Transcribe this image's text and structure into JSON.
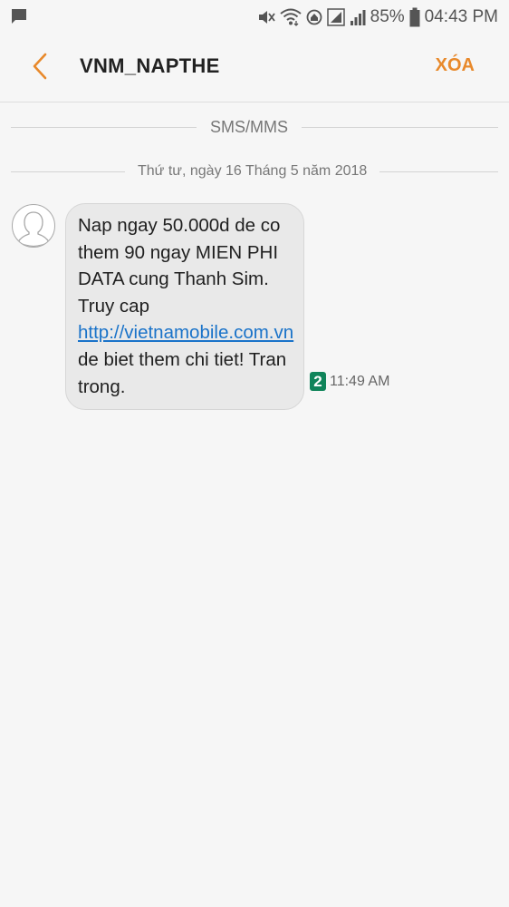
{
  "status_bar": {
    "battery": "85%",
    "time": "04:43 PM",
    "icons": [
      "message-notification-icon",
      "mute-icon",
      "wifi-icon",
      "data-saver-icon",
      "signal-icon",
      "signal-bars-icon",
      "battery-icon"
    ]
  },
  "header": {
    "title": "VNM_NAPTHE",
    "delete_label": "XÓA",
    "back_icon": "chevron-left-icon",
    "accent_color": "#e8892b"
  },
  "conversation": {
    "channel_label": "SMS/MMS",
    "date_label": "Thứ tư, ngày 16 Tháng 5 năm 2018",
    "message": {
      "text_before_link": "Nap ngay 50.000d de co them 90 ngay MIEN PHI DATA cung Thanh Sim. Truy cap ",
      "link_text": "http://vietnamobile.com.vn",
      "text_after_link": " de biet them chi tiet! Tran trong.",
      "sim_slot": "2",
      "time": "11:49 AM",
      "avatar_icon": "person-avatar-icon"
    }
  }
}
